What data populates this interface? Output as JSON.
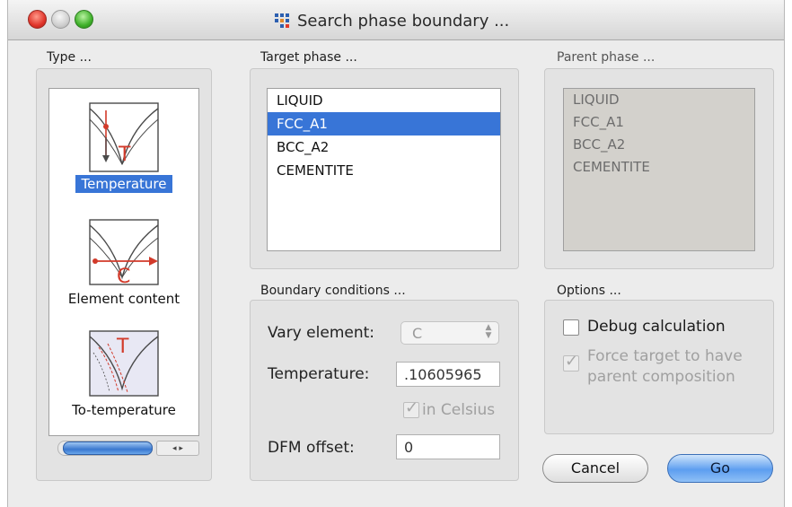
{
  "window": {
    "title": "Search  phase boundary ..."
  },
  "type_group": {
    "label": "Type ...",
    "items": [
      {
        "label": "Temperature",
        "selected": true
      },
      {
        "label": "Element content",
        "selected": false
      },
      {
        "label": "To-temperature",
        "selected": false
      }
    ],
    "scroll_arrows": "◂ ▸"
  },
  "target_phase": {
    "label": "Target phase ...",
    "items": [
      "LIQUID",
      "FCC_A1",
      "BCC_A2",
      "CEMENTITE"
    ],
    "selected": "FCC_A1"
  },
  "parent_phase": {
    "label": "Parent phase ...",
    "items": [
      "LIQUID",
      "FCC_A1",
      "BCC_A2",
      "CEMENTITE"
    ]
  },
  "boundary": {
    "label": "Boundary conditions ...",
    "vary_element_label": "Vary element:",
    "vary_element_value": "C",
    "temperature_label": "Temperature:",
    "temperature_value": ".10605965",
    "in_celsius_label": "in Celsius",
    "dfm_label": "DFM offset:",
    "dfm_value": "0"
  },
  "options": {
    "label": "Options ...",
    "debug_label": "Debug calculation",
    "force_label_1": "Force target to have",
    "force_label_2": "parent composition"
  },
  "buttons": {
    "cancel": "Cancel",
    "go": "Go"
  },
  "colors": {
    "selection": "#3875d7",
    "panel": "#e3e3e3",
    "window": "#ececec"
  }
}
